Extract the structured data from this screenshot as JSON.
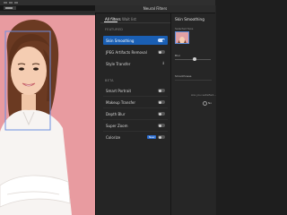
{
  "panel": {
    "title": "Neural Filters"
  },
  "tabs": [
    {
      "label": "All filters",
      "active": true
    },
    {
      "label": "Wait list",
      "active": false
    }
  ],
  "sections": {
    "featured": "FEATURED",
    "beta": "BETA"
  },
  "featured_filters": [
    {
      "label": "Skin Smoothing",
      "control": "toggle",
      "on": true,
      "selected": true
    },
    {
      "label": "JPEG Artifacts Removal",
      "control": "toggle",
      "on": false,
      "selected": false
    },
    {
      "label": "Style Transfer",
      "control": "download",
      "on": false,
      "selected": false
    }
  ],
  "beta_filters": [
    {
      "label": "Smart Portrait",
      "control": "toggle",
      "on": false
    },
    {
      "label": "Makeup Transfer",
      "control": "toggle",
      "on": false
    },
    {
      "label": "Depth Blur",
      "control": "toggle",
      "on": false
    },
    {
      "label": "Super Zoom",
      "control": "toggle",
      "on": false
    },
    {
      "label": "Colorize",
      "control": "toggle",
      "on": false,
      "badge": "New"
    }
  ],
  "settings": {
    "title": "Skin Smoothing",
    "selected_face_label": "Selected face",
    "blur_label": "Blur",
    "blur_level": 0.55,
    "smoothness_label": "Smoothness",
    "notice_text": "Are you satisfied...",
    "option_no": "No"
  },
  "colors": {
    "accent": "#1a5fb4",
    "canvas_background": "#e89ba0",
    "panel_background": "#252525"
  }
}
